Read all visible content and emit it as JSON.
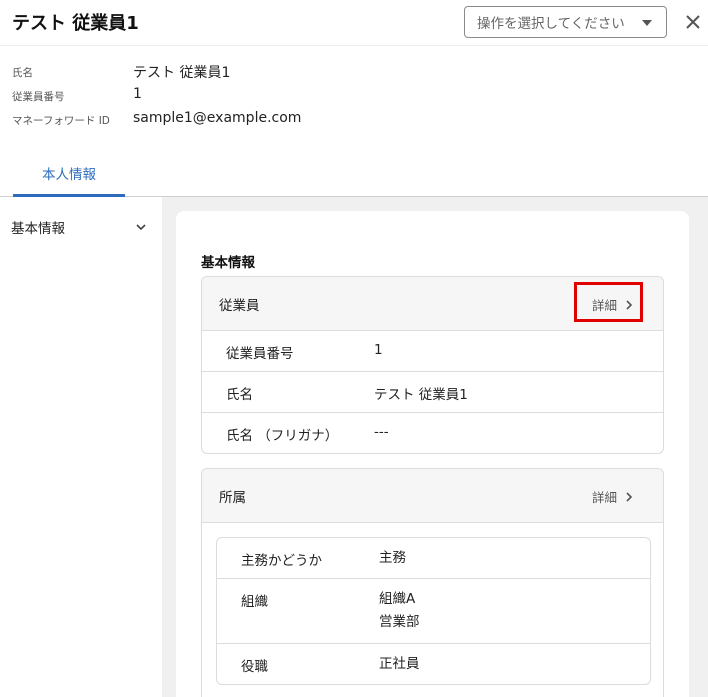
{
  "header": {
    "title": "テスト 従業員1",
    "action_select_placeholder": "操作を選択してください"
  },
  "employee_info": [
    {
      "label": "氏名",
      "value": "テスト 従業員1"
    },
    {
      "label": "従業員番号",
      "value": "1"
    },
    {
      "label": "マネーフォワード ID",
      "value": "sample1@example.com"
    }
  ],
  "tabs": [
    {
      "label": "本人情報",
      "active": true
    }
  ],
  "sidebar": {
    "items": [
      {
        "label": "基本情報"
      }
    ]
  },
  "main": {
    "section_title": "基本情報",
    "panels": [
      {
        "title": "従業員",
        "detail_label": "詳細",
        "rows": [
          {
            "key": "従業員番号",
            "value": "1"
          },
          {
            "key": "氏名",
            "value": "テスト 従業員1"
          },
          {
            "key": "氏名 （フリガナ）",
            "value": "---"
          }
        ]
      },
      {
        "title": "所属",
        "detail_label": "詳細",
        "rows": [
          {
            "key": "主務かどうか",
            "value": "主務"
          },
          {
            "key": "組織",
            "value": "組織A",
            "value2": "営業部"
          },
          {
            "key": "役職",
            "value": "正社員"
          }
        ]
      }
    ]
  },
  "colors": {
    "accent": "#2e6bbf",
    "highlight": "#e00000"
  }
}
